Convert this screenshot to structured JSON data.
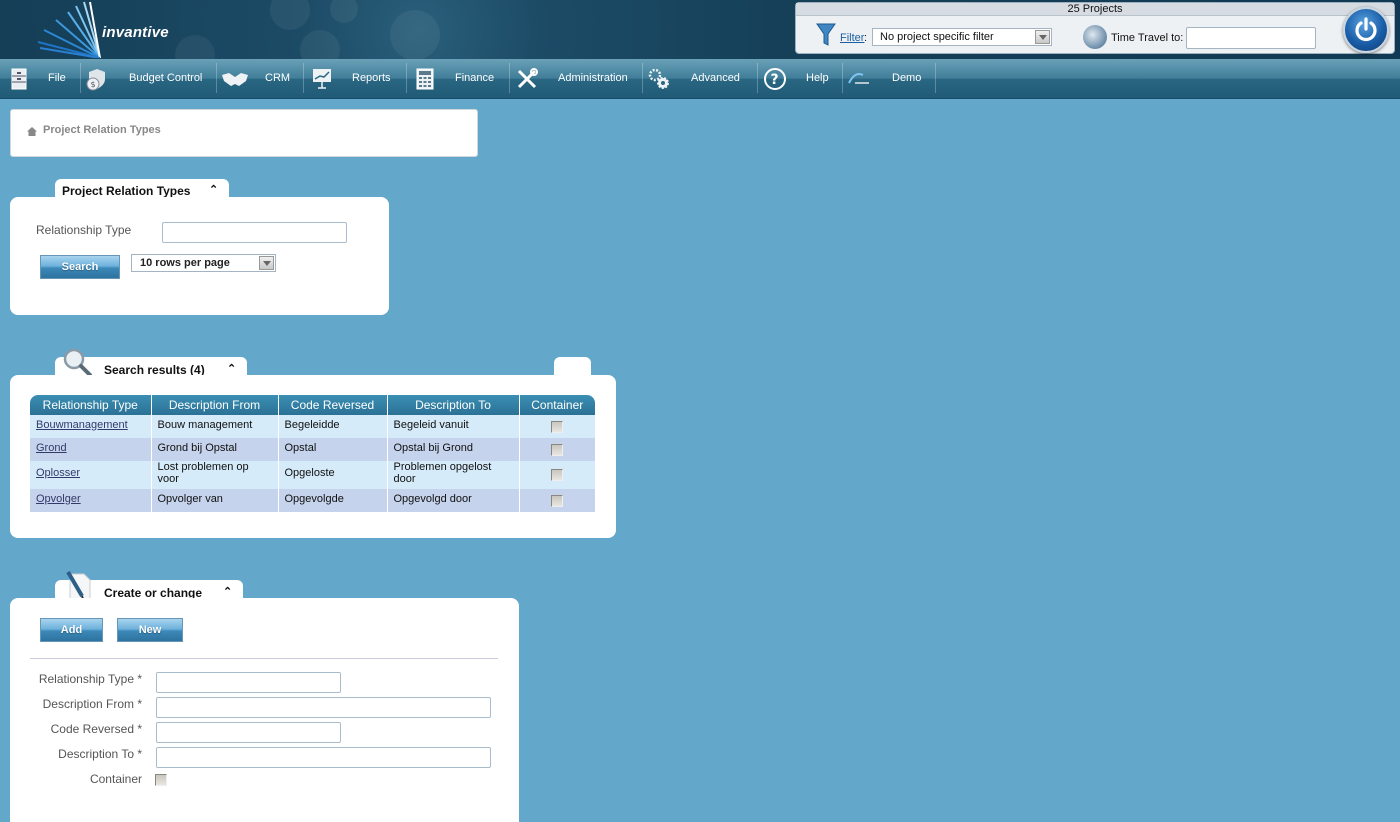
{
  "header": {
    "logo_text": "invantive",
    "project_count": "25 Projects",
    "filter_label": "Filter",
    "filter_colon": ":",
    "filter_value": "No project specific filter",
    "time_travel_label": "Time Travel to:",
    "time_travel_value": ""
  },
  "nav": {
    "items": [
      {
        "label": "File",
        "icon": "file-cabinet-icon"
      },
      {
        "label": "Budget Control",
        "icon": "money-bag-icon"
      },
      {
        "label": "CRM",
        "icon": "handshake-icon"
      },
      {
        "label": "Reports",
        "icon": "presentation-chart-icon"
      },
      {
        "label": "Finance",
        "icon": "calculator-icon"
      },
      {
        "label": "Administration",
        "icon": "tools-icon"
      },
      {
        "label": "Advanced",
        "icon": "gears-icon"
      },
      {
        "label": "Help",
        "icon": "question-icon"
      },
      {
        "label": "Demo",
        "icon": "demo-logo-icon"
      }
    ]
  },
  "breadcrumb": {
    "current": "Project Relation Types"
  },
  "search_panel": {
    "title": "Project Relation Types",
    "relationship_type_label": "Relationship Type",
    "relationship_type_value": "",
    "search_button": "Search",
    "rows_per_page": "10 rows per page"
  },
  "results_panel": {
    "title": "Search results (4)",
    "columns": [
      "Relationship Type",
      "Description From",
      "Code Reversed",
      "Description To",
      "Container"
    ],
    "rows": [
      {
        "type": "Bouwmanagement",
        "from": "Bouw management",
        "reversed": "Begeleidde",
        "to": "Begeleid vanuit",
        "container": false
      },
      {
        "type": "Grond",
        "from": "Grond bij Opstal",
        "reversed": "Opstal",
        "to": "Opstal bij Grond",
        "container": false
      },
      {
        "type": "Oplosser",
        "from": "Lost problemen op voor",
        "reversed": "Opgeloste",
        "to": "Problemen opgelost door",
        "container": false
      },
      {
        "type": "Opvolger",
        "from": "Opvolger van",
        "reversed": "Opgevolgde",
        "to": "Opgevolgd door",
        "container": false
      }
    ]
  },
  "create_panel": {
    "title": "Create or change",
    "add_button": "Add",
    "new_button": "New",
    "fields": {
      "relationship_type_label": "Relationship Type *",
      "description_from_label": "Description From *",
      "code_reversed_label": "Code Reversed *",
      "description_to_label": "Description To *",
      "container_label": "Container"
    },
    "values": {
      "relationship_type": "",
      "description_from": "",
      "code_reversed": "",
      "description_to": "",
      "container": false
    }
  },
  "colors": {
    "page_bg": "#63a8cb",
    "header_bg": "#153e57",
    "nav_bg": "#2a6783",
    "table_header": "#2c7196",
    "row_odd": "#d6ebfa",
    "row_even": "#c5d3ec",
    "link": "#333a6a"
  }
}
